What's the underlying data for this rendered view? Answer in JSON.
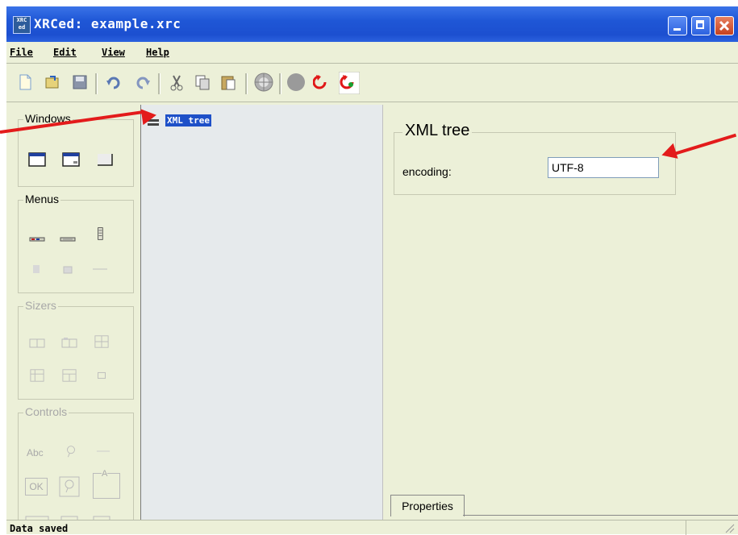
{
  "window": {
    "title": "XRCed: example.xrc",
    "app_icon_text": "XRC ed"
  },
  "menu": [
    {
      "label": "File",
      "underline": "F"
    },
    {
      "label": "Edit",
      "underline": "E"
    },
    {
      "label": "View",
      "underline": "V"
    },
    {
      "label": "Help",
      "underline": "H"
    }
  ],
  "toolbar": {
    "icons": [
      "new-file-icon",
      "open-file-icon",
      "save-icon",
      "undo-icon",
      "redo-icon",
      "cut-icon",
      "copy-icon",
      "paste-icon",
      "locate-icon",
      "test-icon",
      "refresh-icon",
      "auto-refresh-icon"
    ]
  },
  "palette": {
    "windows_label": "Windows",
    "menus_label": "Menus",
    "sizers_label": "Sizers",
    "controls_label": "Controls",
    "controls_text_icon": "Abc",
    "controls_ok_icon": "OK",
    "controls_static_icon": "A"
  },
  "tree": {
    "root_label": "XML tree",
    "root_icon": "tree-root-icon"
  },
  "properties": {
    "title": "XML tree",
    "encoding_label": "encoding:",
    "encoding_value": "UTF-8",
    "tab_label": "Properties"
  },
  "status": {
    "text": "Data saved"
  },
  "colors": {
    "titlebar": "#1f57d6",
    "window_bg": "#ecf0d8",
    "selection": "#1e50c8",
    "annotation_arrow": "#e31b1b"
  }
}
